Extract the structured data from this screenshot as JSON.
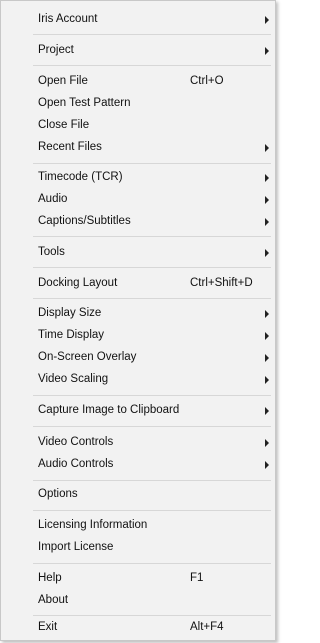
{
  "menu": {
    "items": [
      {
        "label": "Iris Account",
        "shortcut": "",
        "submenu": true
      },
      {
        "label": "Project",
        "shortcut": "",
        "submenu": true
      },
      {
        "label": "Open File",
        "shortcut": "Ctrl+O",
        "submenu": false
      },
      {
        "label": "Open Test Pattern",
        "shortcut": "",
        "submenu": false
      },
      {
        "label": "Close File",
        "shortcut": "",
        "submenu": false
      },
      {
        "label": "Recent Files",
        "shortcut": "",
        "submenu": true
      },
      {
        "label": "Timecode (TCR)",
        "shortcut": "",
        "submenu": true
      },
      {
        "label": "Audio",
        "shortcut": "",
        "submenu": true
      },
      {
        "label": "Captions/Subtitles",
        "shortcut": "",
        "submenu": true
      },
      {
        "label": "Tools",
        "shortcut": "",
        "submenu": true
      },
      {
        "label": "Docking Layout",
        "shortcut": "Ctrl+Shift+D",
        "submenu": false
      },
      {
        "label": "Display Size",
        "shortcut": "",
        "submenu": true
      },
      {
        "label": "Time Display",
        "shortcut": "",
        "submenu": true
      },
      {
        "label": "On-Screen Overlay",
        "shortcut": "",
        "submenu": true
      },
      {
        "label": "Video Scaling",
        "shortcut": "",
        "submenu": true
      },
      {
        "label": "Capture Image to Clipboard",
        "shortcut": "",
        "submenu": true
      },
      {
        "label": "Video Controls",
        "shortcut": "",
        "submenu": true
      },
      {
        "label": "Audio Controls",
        "shortcut": "",
        "submenu": true
      },
      {
        "label": "Options",
        "shortcut": "",
        "submenu": false
      },
      {
        "label": "Licensing Information",
        "shortcut": "",
        "submenu": false
      },
      {
        "label": "Import License",
        "shortcut": "",
        "submenu": false
      },
      {
        "label": "Help",
        "shortcut": "F1",
        "submenu": false
      },
      {
        "label": "About",
        "shortcut": "",
        "submenu": false
      },
      {
        "label": "Exit",
        "shortcut": "Alt+F4",
        "submenu": false
      }
    ]
  }
}
